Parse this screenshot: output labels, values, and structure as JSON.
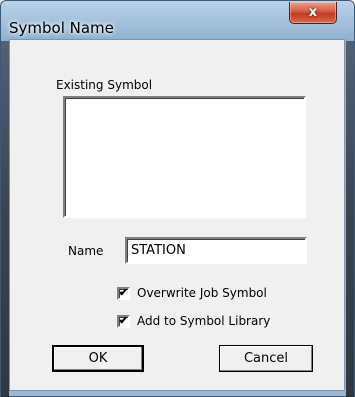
{
  "window": {
    "title": "Symbol Name",
    "close_glyph": "x"
  },
  "existing_symbol": {
    "label": "Existing Symbol",
    "items": []
  },
  "name_field": {
    "label": "Name",
    "value": "STATION"
  },
  "options": {
    "overwrite": {
      "label": "Overwrite Job Symbol",
      "checked": true
    },
    "add_library": {
      "label": "Add to Symbol Library",
      "checked": true
    }
  },
  "buttons": {
    "ok": "OK",
    "cancel": "Cancel"
  },
  "check_glyph": "✔"
}
